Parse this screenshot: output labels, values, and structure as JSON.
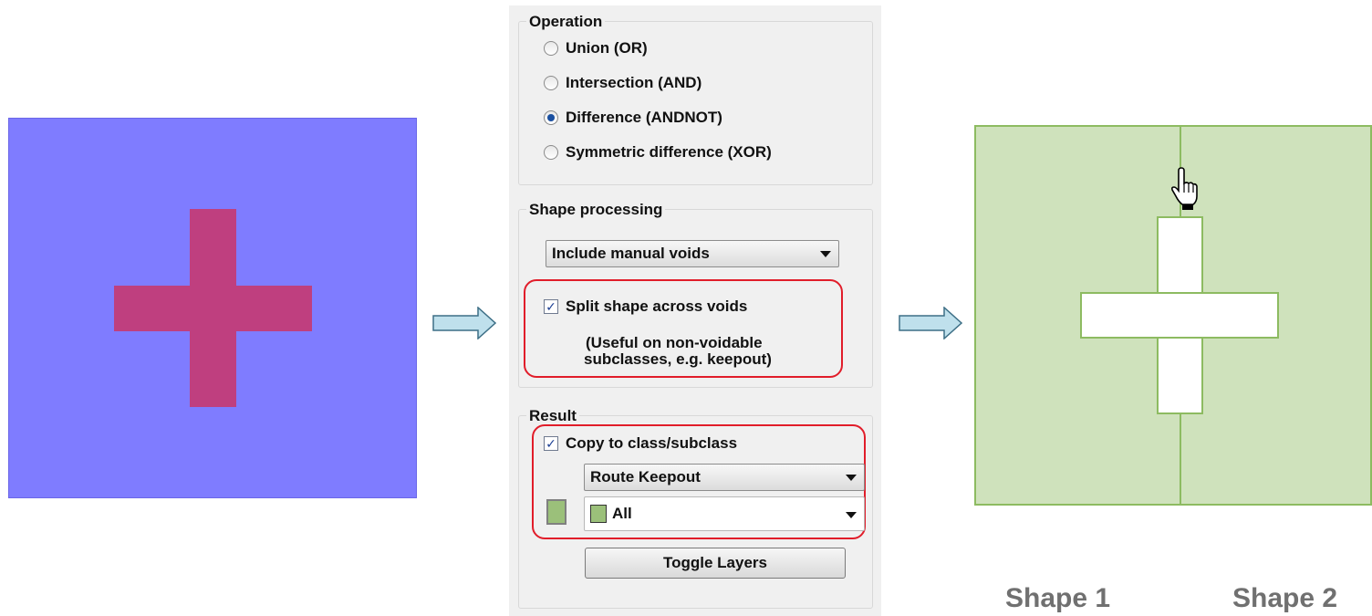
{
  "operation": {
    "title": "Operation",
    "options": [
      {
        "label": "Union (OR)",
        "selected": false
      },
      {
        "label": "Intersection (AND)",
        "selected": false
      },
      {
        "label": "Difference (ANDNOT)",
        "selected": true
      },
      {
        "label": "Symmetric difference (XOR)",
        "selected": false
      }
    ]
  },
  "shape_processing": {
    "title": "Shape processing",
    "voids_select": "Include manual voids",
    "split_checkbox": {
      "label": "Split shape across voids",
      "checked": true
    },
    "note_line1": "(Useful on non-voidable",
    "note_line2": "subclasses, e.g. keepout)"
  },
  "result": {
    "title": "Result",
    "copy_checkbox": {
      "label": "Copy to class/subclass",
      "checked": true
    },
    "class_select": "Route Keepout",
    "subclass_select": "All",
    "toggle_button": "Toggle Layers",
    "swatch_color": "#9bc07a"
  },
  "colors": {
    "input_shape": "#7f7cff",
    "input_plus": "#bf3f7f",
    "result_shape": "#cfe2bc",
    "highlight": "#e11d2a"
  },
  "captions": {
    "shape1": "Shape 1",
    "shape2": "Shape 2"
  },
  "icons": [
    "arrow-right-icon",
    "hand-pointer-icon",
    "chevron-down-icon"
  ]
}
